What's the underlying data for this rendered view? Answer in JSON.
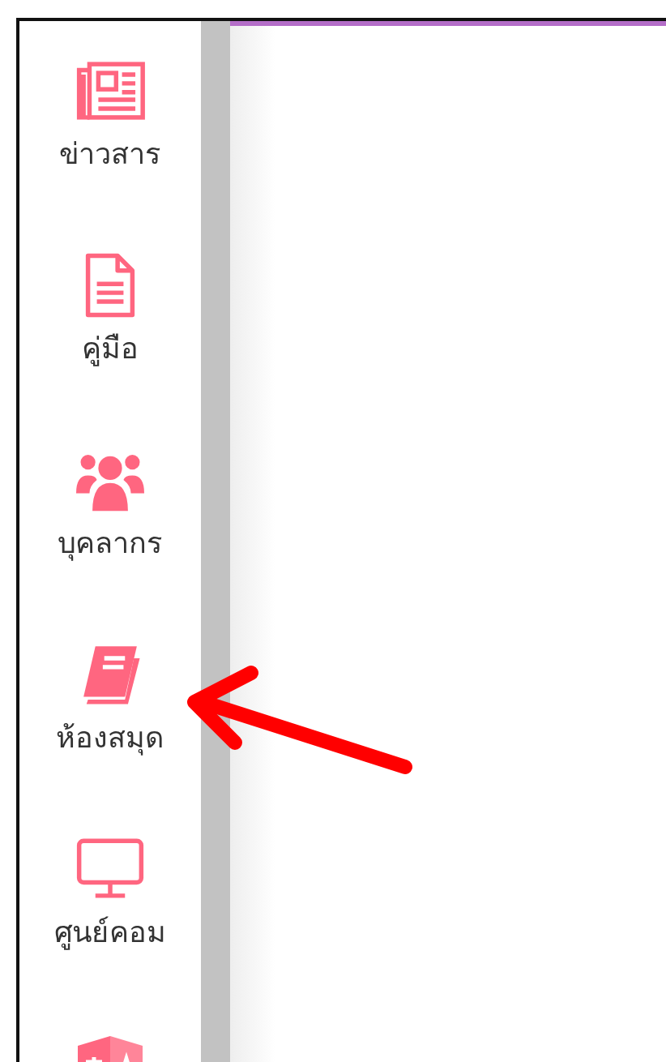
{
  "sidebar": {
    "items": [
      {
        "kind": "labeled",
        "label": "ข่าวสาร"
      },
      {
        "kind": "labeled",
        "label": "คู่มือ"
      },
      {
        "kind": "labeled",
        "label": "บุคลากร"
      },
      {
        "kind": "labeled",
        "label": "ห้องสมุด"
      },
      {
        "kind": "labeled",
        "label": "ศูนย์คอม"
      },
      {
        "kind": "icon-only"
      }
    ]
  }
}
